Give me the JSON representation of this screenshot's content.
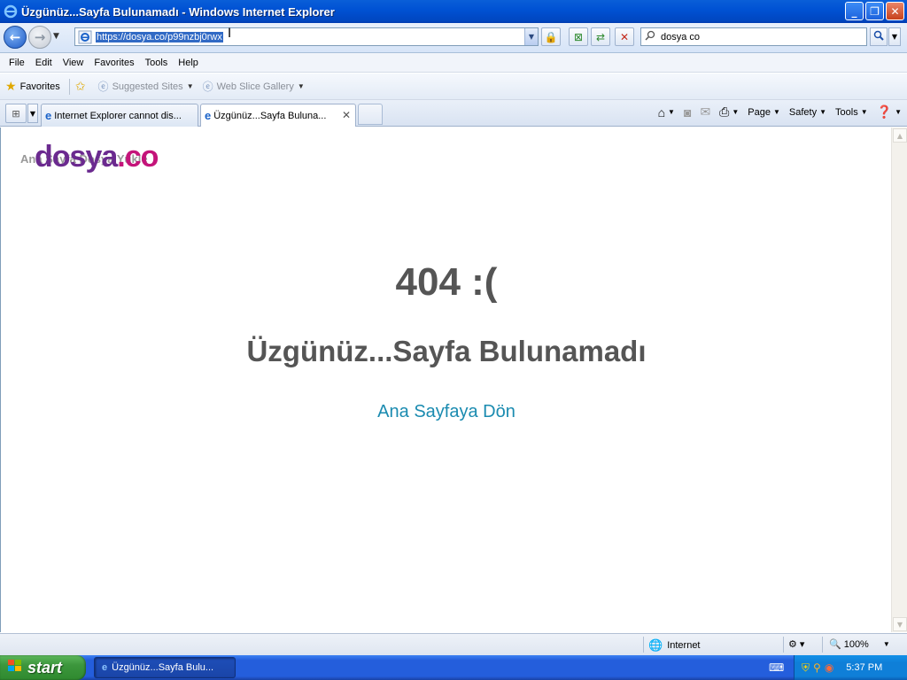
{
  "window": {
    "title": "Üzgünüz...Sayfa Bulunamadı - Windows Internet Explorer",
    "controls": {
      "minimize": "_",
      "maximize": "❐",
      "close": "✕"
    }
  },
  "address_bar": {
    "url": "https://dosya.co/p99nzbj0rwx",
    "search_value": "dosya co"
  },
  "menu": [
    "File",
    "Edit",
    "View",
    "Favorites",
    "Tools",
    "Help"
  ],
  "favorites_bar": {
    "favorites_label": "Favorites",
    "suggested_sites": "Suggested Sites",
    "web_slice_gallery": "Web Slice Gallery"
  },
  "tabs": [
    {
      "label": "Internet Explorer cannot dis...",
      "active": false
    },
    {
      "label": "Üzgünüz...Sayfa Buluna...",
      "active": true
    }
  ],
  "command_bar": {
    "page": "Page",
    "safety": "Safety",
    "tools": "Tools"
  },
  "content": {
    "logo_underlay_text": "Ana Sayfa   Dosya Yükle",
    "logo_part1": "dosya",
    "logo_part2": ".co",
    "error_code": "404 :(",
    "error_message": "Üzgünüz...Sayfa Bulunamadı",
    "home_link": "Ana Sayfaya Dön"
  },
  "status_bar": {
    "zone": "Internet",
    "zoom": "100%"
  },
  "taskbar": {
    "start": "start",
    "task_item": "Üzgünüz...Sayfa Bulu...",
    "clock": "5:37 PM"
  },
  "colors": {
    "logo_purple": "#6b2a8f",
    "logo_magenta": "#c4147a",
    "link": "#1a8bb0",
    "heading": "#555555"
  }
}
